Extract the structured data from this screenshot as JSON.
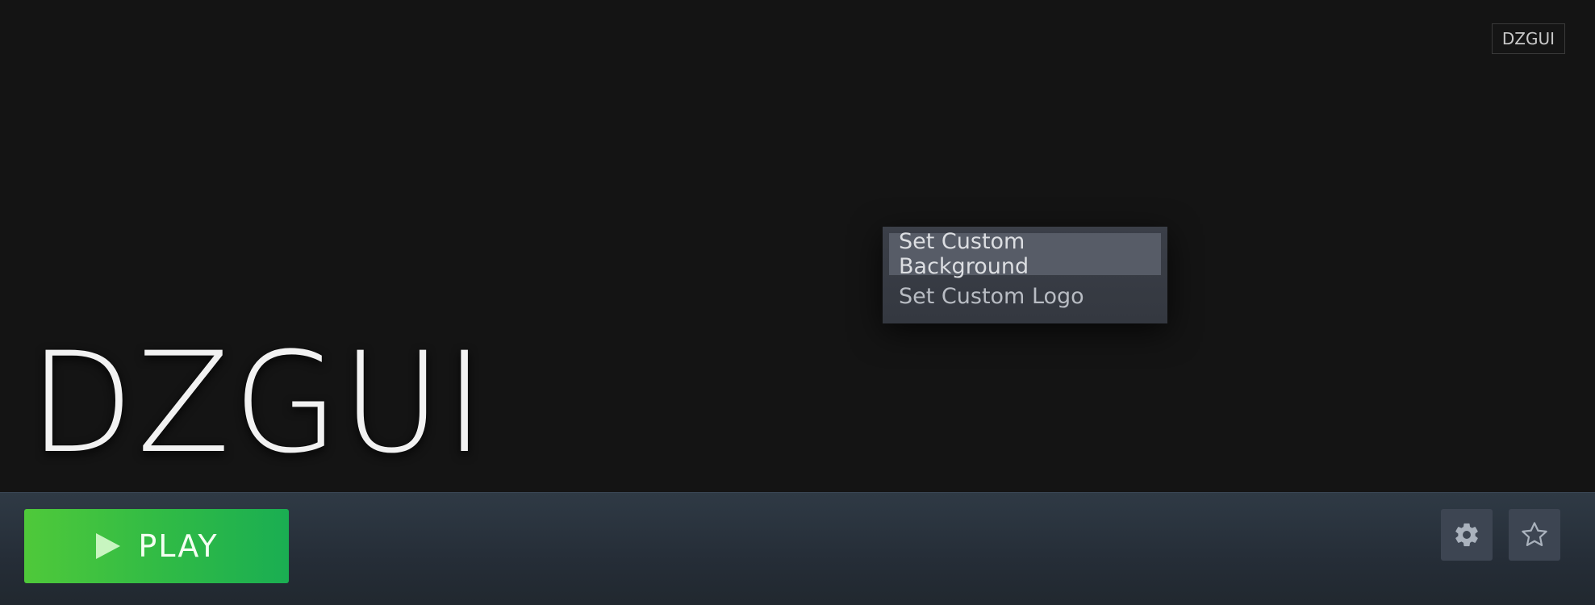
{
  "window": {
    "name_tag": "DZGUI"
  },
  "hero": {
    "logo_text": "DZGUI"
  },
  "context_menu": {
    "items": [
      {
        "label": "Set Custom Background",
        "state": "highlighted"
      },
      {
        "label": "Set Custom Logo"
      }
    ]
  },
  "bottom_bar": {
    "play_label": "PLAY",
    "play_icon": "play-triangle-icon",
    "settings_icon": "gear-icon",
    "favorite_icon": "star-outline-icon"
  },
  "colors": {
    "background": "#141414",
    "menu_bg": "#393d46",
    "menu_highlight": "#575c67",
    "play_green_start": "#4fc93a",
    "play_green_end": "#1aae52",
    "bar_bg": "#2a333d",
    "icon_button_bg": "#3d4552"
  }
}
